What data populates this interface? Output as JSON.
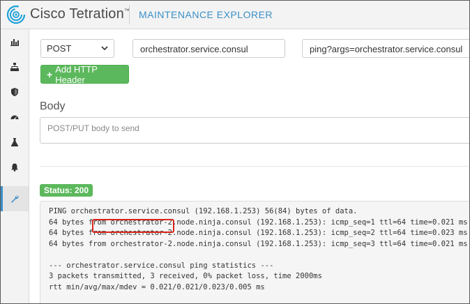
{
  "header": {
    "brand": "Cisco Tetration",
    "trademark": "™",
    "section_title": "MAINTENANCE EXPLORER"
  },
  "sidebar": {
    "items": [
      {
        "icon": "bar-chart-icon",
        "active": false
      },
      {
        "icon": "hierarchy-icon",
        "active": false
      },
      {
        "icon": "shield-icon",
        "active": false
      },
      {
        "icon": "dashboard-gauge-icon",
        "active": false
      },
      {
        "icon": "flask-icon",
        "active": false
      },
      {
        "icon": "bell-icon",
        "active": false
      },
      {
        "icon": "wrench-icon",
        "active": true
      }
    ]
  },
  "request": {
    "method": "POST",
    "host": "orchestrator.service.consul",
    "path": "ping?args=orchestrator.service.consul",
    "add_header_label": "Add HTTP Header"
  },
  "body": {
    "heading": "Body",
    "placeholder": "POST/PUT body to send"
  },
  "response": {
    "status": "Status: 200",
    "lines": [
      "PING orchestrator.service.consul (192.168.1.253) 56(84) bytes of data.",
      "64 bytes from orchestrator-2.node.ninja.consul (192.168.1.253): icmp_seq=1 ttl=64 time=0.021 ms",
      "64 bytes from orchestrator-2.node.ninja.consul (192.168.1.253): icmp_seq=2 ttl=64 time=0.023 ms",
      "64 bytes from orchestrator-2.node.ninja.consul (192.168.1.253): icmp_seq=3 ttl=64 time=0.021 ms",
      "",
      "--- orchestrator.service.consul ping statistics ---",
      "3 packets transmitted, 3 received, 0% packet loss, time 2000ms",
      "rtt min/avg/max/mdev = 0.021/0.021/0.023/0.005 ms"
    ]
  },
  "colors": {
    "accent": "#3a8fc7",
    "success": "#5cb85c",
    "highlight": "#d9261c"
  }
}
